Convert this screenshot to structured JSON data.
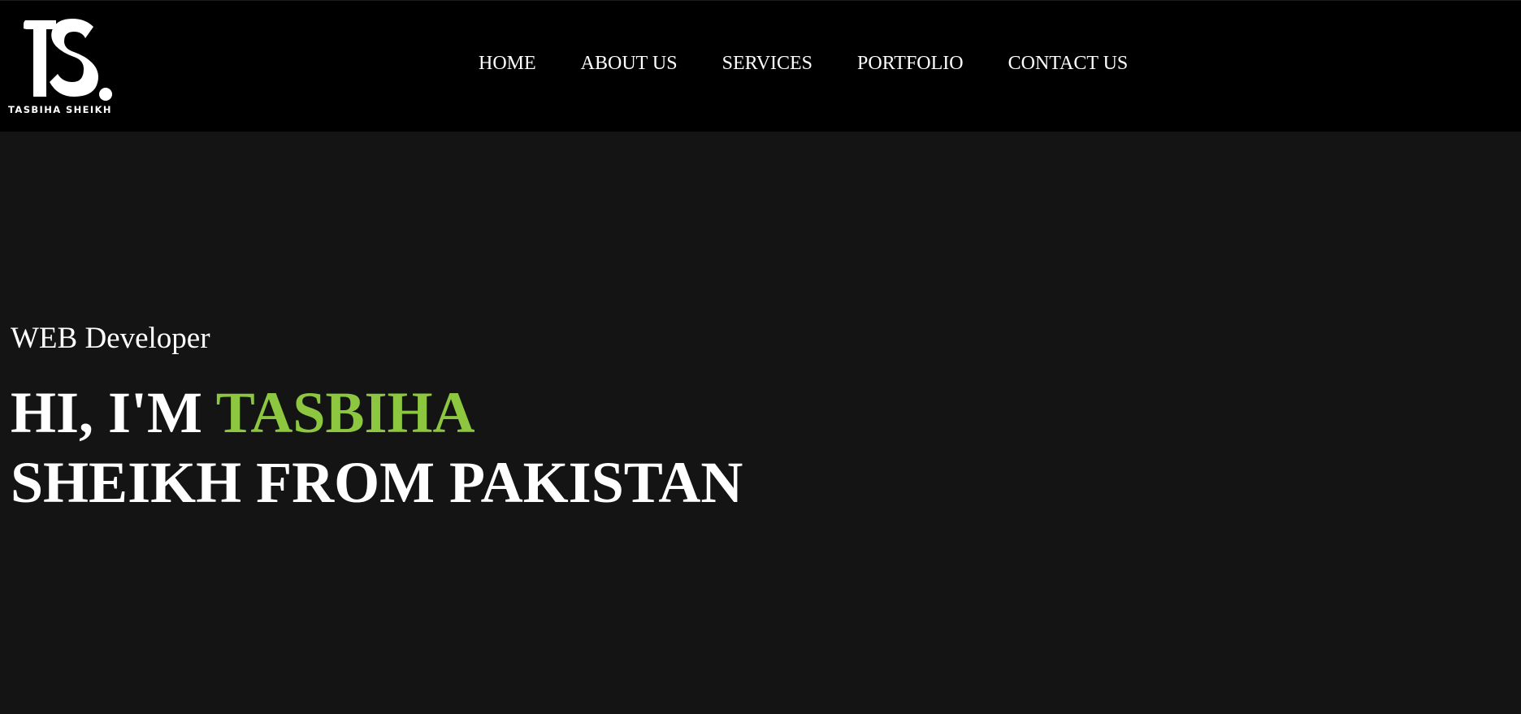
{
  "brand": {
    "logo_text": "TASBIHA SHEIKH",
    "logo_icon": "ts-monogram-icon"
  },
  "nav": {
    "items": [
      {
        "label": "HOME"
      },
      {
        "label": "ABOUT US"
      },
      {
        "label": "SERVICES"
      },
      {
        "label": "PORTFOLIO"
      },
      {
        "label": "CONTACT US"
      }
    ]
  },
  "hero": {
    "role": "WEB Developer",
    "greeting": "HI, I'M",
    "first_name": "TASBIHA",
    "line2": "SHEIKH FROM PAKISTAN"
  },
  "colors": {
    "nav_background": "#000000",
    "page_background": "#141414",
    "text": "#ffffff",
    "accent": "#8dc63f"
  }
}
